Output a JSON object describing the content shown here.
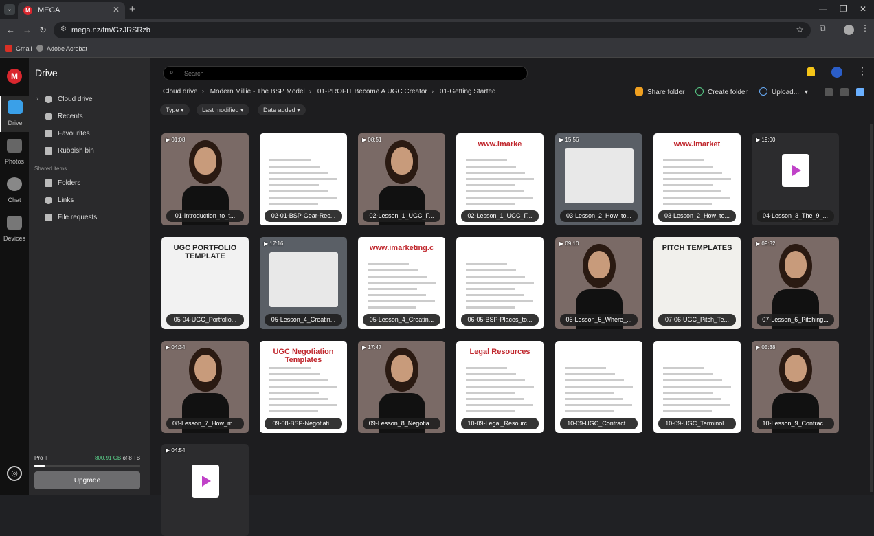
{
  "browser": {
    "tab_title": "MEGA",
    "favicon": "M",
    "url": "mega.nz/fm/GzJRSRzb",
    "bookmarks": [
      "Gmail",
      "Adobe Acrobat"
    ]
  },
  "rail": {
    "logo": "M",
    "items": [
      "Drive",
      "Photos",
      "Chat",
      "Devices"
    ]
  },
  "sidebar": {
    "title": "Drive",
    "items": [
      "Cloud drive",
      "Recents",
      "Favourites",
      "Rubbish bin"
    ],
    "shared_heading": "Shared items",
    "shared_items": [
      "Folders",
      "Links",
      "File requests"
    ],
    "plan": "Pro II",
    "storage_used": "800.91 GB",
    "storage_total": "of 8 TB",
    "storage_fraction": 0.1,
    "upgrade_label": "Upgrade"
  },
  "main": {
    "search_placeholder": "Search",
    "breadcrumbs": [
      "Cloud drive",
      "Modern Millie - The BSP Model",
      "01-PROFIT Become A UGC Creator",
      "01-Getting Started"
    ],
    "actions": {
      "share": "Share folder",
      "create": "Create folder",
      "upload": "Upload..."
    },
    "filters": [
      "Type",
      "Last modified",
      "Date added"
    ],
    "files": [
      {
        "name": "01-Introduction_to_t...",
        "duration": "01:08",
        "kind": "video"
      },
      {
        "name": "02-01-BSP-Gear-Rec...",
        "duration": "",
        "kind": "doc-gear"
      },
      {
        "name": "02-Lesson_1_UGC_F...",
        "duration": "08:51",
        "kind": "video"
      },
      {
        "name": "02-Lesson_1_UGC_F...",
        "duration": "",
        "kind": "doc",
        "caption": "www.imarke"
      },
      {
        "name": "03-Lesson_2_How_to...",
        "duration": "15:56",
        "kind": "screen"
      },
      {
        "name": "03-Lesson_2_How_to...",
        "duration": "",
        "kind": "doc",
        "caption": "www.imarket"
      },
      {
        "name": "04-Lesson_3_The_9_...",
        "duration": "19:00",
        "kind": "placeholder"
      },
      {
        "name": "05-04-UGC_Portfolio...",
        "duration": "",
        "kind": "ugc",
        "caption": "UGC PORTFOLIO TEMPLATE"
      },
      {
        "name": "05-Lesson_4_Creatin...",
        "duration": "17:16",
        "kind": "screen"
      },
      {
        "name": "05-Lesson_4_Creatin...",
        "duration": "",
        "kind": "doc",
        "caption": "www.imarketing.c"
      },
      {
        "name": "06-05-BSP-Places_to...",
        "duration": "",
        "kind": "doc"
      },
      {
        "name": "06-Lesson_5_Where_...",
        "duration": "09:10",
        "kind": "video"
      },
      {
        "name": "07-06-UGC_Pitch_Te...",
        "duration": "",
        "kind": "pitch",
        "caption": "PITCH TEMPLATES"
      },
      {
        "name": "07-Lesson_6_Pitching...",
        "duration": "09:32",
        "kind": "video"
      },
      {
        "name": "08-Lesson_7_How_m...",
        "duration": "04:34",
        "kind": "video"
      },
      {
        "name": "09-08-BSP-Negotiati...",
        "duration": "",
        "kind": "doc",
        "caption": "UGC Negotiation Templates"
      },
      {
        "name": "09-Lesson_8_Negotia...",
        "duration": "17:47",
        "kind": "video"
      },
      {
        "name": "10-09-Legal_Resourc...",
        "duration": "",
        "kind": "doc",
        "caption": "Legal Resources"
      },
      {
        "name": "10-09-UGC_Contract...",
        "duration": "",
        "kind": "doc"
      },
      {
        "name": "10-09-UGC_Terminol...",
        "duration": "",
        "kind": "doc"
      },
      {
        "name": "10-Lesson_9_Contrac...",
        "duration": "05:38",
        "kind": "video"
      },
      {
        "name": "",
        "duration": "04:54",
        "kind": "placeholder"
      }
    ]
  }
}
